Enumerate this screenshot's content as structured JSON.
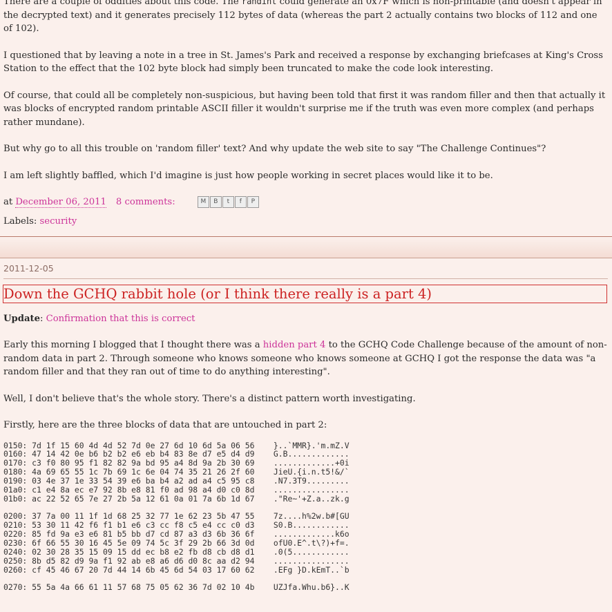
{
  "post1": {
    "paragraphs": [
      {
        "pre": "There are a couple of oddities about this code. The ",
        "code": "randint",
        "post": " could generate an 0x7F which is non-printable (and doesn't appear in the decrypted text) and it generates precisely 112 bytes of data (whereas the part 2 actually contains two blocks of 112 and one of 102)."
      },
      {
        "text": "I questioned that by leaving a note in a tree in St. James's Park and received a response by exchanging briefcases at King's Cross Station to the effect that the 102 byte block had simply been truncated to make the code look interesting."
      },
      {
        "text": "Of course, that could all be completely non-suspicious, but having been told that first it was random filler and then that actually it was blocks of encrypted random printable ASCII filler it wouldn't surprise me if the truth was even more complex (and perhaps rather mundane)."
      },
      {
        "text": "But why go to all this trouble on 'random filler' text? And why update the web site to say \"The Challenge Continues\"?"
      },
      {
        "text": "I am left slightly baffled, which I'd imagine is just how people working in secret places would like it to be."
      }
    ],
    "footer_at": "at ",
    "date": "December 06, 2011",
    "comments": "8 comments:",
    "share_icons": [
      "email-icon",
      "blog-this-icon",
      "twitter-icon",
      "facebook-icon",
      "pinterest-icon"
    ],
    "labels_prefix": "Labels: ",
    "label": "security"
  },
  "post2": {
    "date_header": "2011-12-05",
    "title": "Down the GCHQ rabbit hole (or I think there really is a part 4)",
    "update_label": "Update",
    "update_sep": ": ",
    "update_link": "Confirmation that this is correct",
    "p1_pre": "Early this morning I blogged that I thought there was a ",
    "p1_link": "hidden part 4",
    "p1_post": " to the GCHQ Code Challenge because of the amount of non-random data in part 2. Through someone who knows someone who knows someone at GCHQ I got the response the data was \"a random filler and that they ran out of time to do anything interesting\".",
    "p2": "Well, I don't believe that's the whole story. There's a distinct pattern worth investigating.",
    "p3": "Firstly, here are the three blocks of data that are untouched in part 2:",
    "hex_block1": "0150: 7d 1f 15 60 4d 4d 52 7d 0e 27 6d 10 6d 5a 06 56    }..`MMR}.'m.mZ.V\n0160: 47 14 42 0e b6 b2 b2 e6 eb b4 83 8e d7 e5 d4 d9    G.B.............\n0170: c3 f0 80 95 f1 82 82 9a bd 95 a4 8d 9a 2b 30 69    .............+0i\n0180: 4a 69 65 55 1c 7b 69 1c 6e 04 74 35 21 26 2f 60    JieU.{i.n.t5!&/`\n0190: 03 4e 37 1e 33 54 39 e6 ba b4 a2 ad a4 c5 95 c8    .N7.3T9.........\n01a0: c1 e4 8a ec e7 92 8b e8 81 f0 ad 98 a4 d0 c0 8d    ................\n01b0: ac 22 52 65 7e 27 2b 5a 12 61 0a 01 7a 6b 1d 67    .\"Re~'+Z.a..zk.g",
    "hex_block2": "0200: 37 7a 00 11 1f 1d 68 25 32 77 1e 62 23 5b 47 55    7z....h%2w.b#[GU\n0210: 53 30 11 42 f6 f1 b1 e6 c3 cc f8 c5 e4 cc c0 d3    S0.B............\n0220: 85 fd 9a e3 e6 81 b5 bb d7 cd 87 a3 d3 6b 36 6f    .............k6o\n0230: 6f 66 55 30 16 45 5e 09 74 5c 3f 29 2b 66 3d 0d    ofU0.E^.t\\?)+f=.\n0240: 02 30 28 35 15 09 15 dd ec b8 e2 fb d8 cb d8 d1    .0(5............\n0250: 8b d5 82 d9 9a f1 92 ab e8 a6 d6 d0 8c aa d2 94    ................\n0260: cf 45 46 67 20 7d 44 14 6b 45 6d 54 03 17 60 62    .EFg }D.kEmT..`b",
    "hex_block3": "0270: 55 5a 4a 66 61 11 57 68 75 05 62 36 7d 02 10 4b    UZJfa.Whu.b6}..K"
  }
}
